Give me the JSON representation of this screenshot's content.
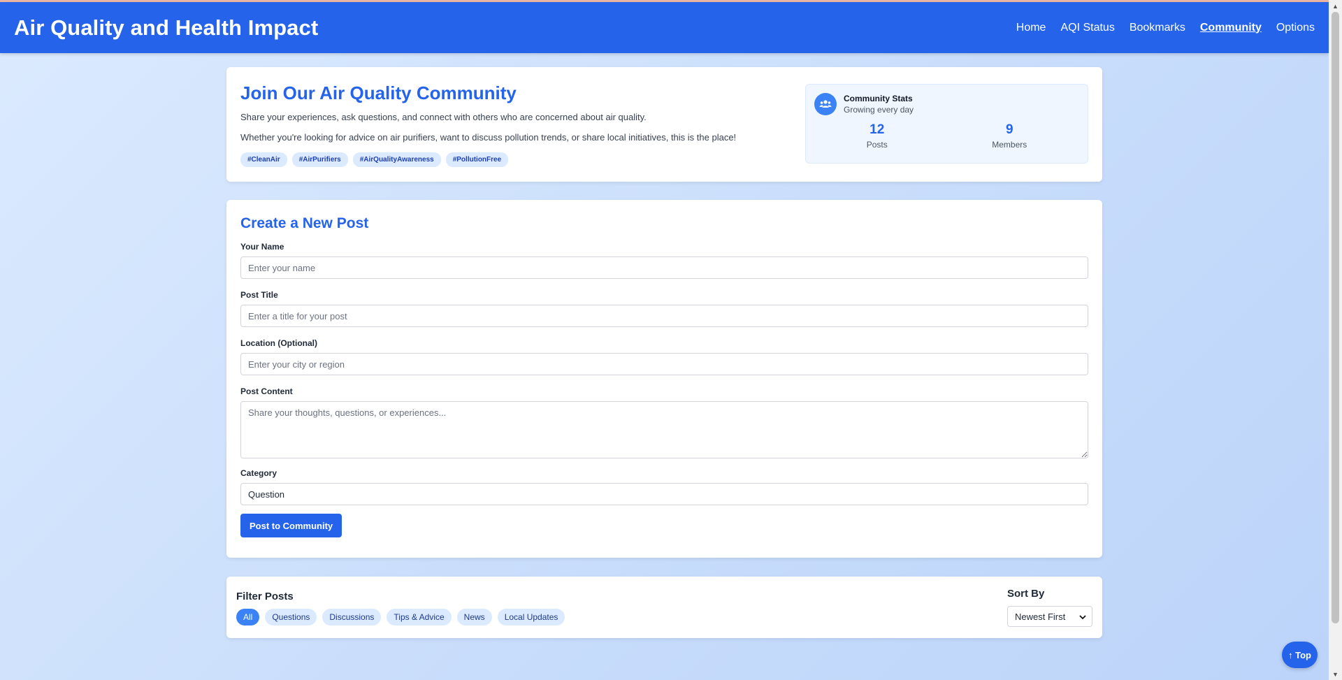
{
  "header": {
    "title": "Air Quality and Health Impact",
    "nav": [
      "Home",
      "AQI Status",
      "Bookmarks",
      "Community",
      "Options"
    ],
    "active_nav": "Community"
  },
  "hero": {
    "title": "Join Our Air Quality Community",
    "intro": "Share your experiences, ask questions, and connect with others who are concerned about air quality.",
    "detail": "Whether you're looking for advice on air purifiers, want to discuss pollution trends, or share local initiatives, this is the place!",
    "tags": [
      "#CleanAir",
      "#AirPurifiers",
      "#AirQualityAwareness",
      "#PollutionFree"
    ],
    "stats": {
      "title": "Community Stats",
      "subtitle": "Growing every day",
      "posts_count": "12",
      "posts_label": "Posts",
      "members_count": "9",
      "members_label": "Members"
    }
  },
  "form": {
    "title": "Create a New Post",
    "name_label": "Your Name",
    "name_placeholder": "Enter your name",
    "title_label": "Post Title",
    "title_placeholder": "Enter a title for your post",
    "location_label": "Location (Optional)",
    "location_placeholder": "Enter your city or region",
    "content_label": "Post Content",
    "content_placeholder": "Share your thoughts, questions, or experiences...",
    "category_label": "Category",
    "category_value": "Question",
    "submit_label": "Post to Community"
  },
  "filter": {
    "title": "Filter Posts",
    "chips": [
      "All",
      "Questions",
      "Discussions",
      "Tips & Advice",
      "News",
      "Local Updates"
    ],
    "active_chip": "All",
    "sort_label": "Sort By",
    "sort_value": "Newest First"
  },
  "top_button": "↑ Top",
  "colors": {
    "primary": "#2563eb",
    "tag_bg": "#dbeafe",
    "page_bg": "#dbeafe"
  }
}
